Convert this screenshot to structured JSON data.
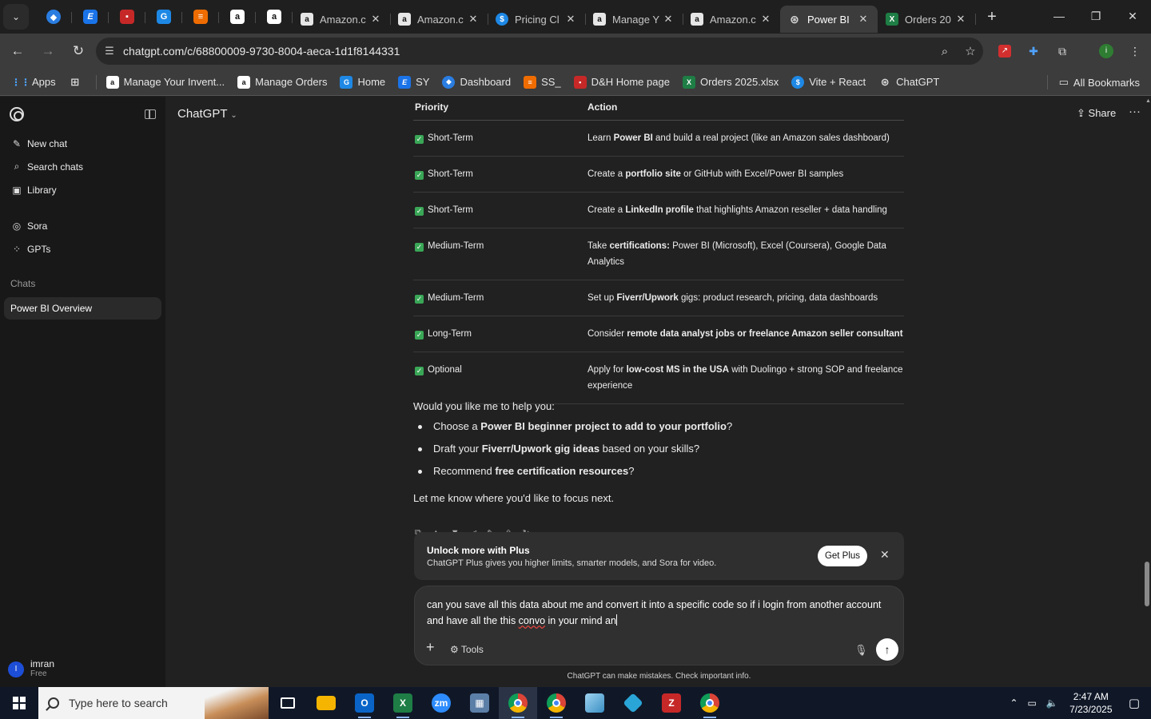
{
  "browser": {
    "tabs": [
      {
        "title": "Amazon.c",
        "icon_letter": "a"
      },
      {
        "title": "Amazon.c",
        "icon_letter": "a"
      },
      {
        "title": "Pricing Cl",
        "icon_letter": "$"
      },
      {
        "title": "Manage Y",
        "icon_letter": "a"
      },
      {
        "title": "Amazon.c",
        "icon_letter": "a"
      },
      {
        "title": "Power BI",
        "icon_letter": "⊛",
        "active": true
      },
      {
        "title": "Orders 20",
        "icon_letter": "X"
      }
    ],
    "url": "chatgpt.com/c/68800009-9730-8004-aeca-1d1f8144331",
    "bookmarks": [
      {
        "label": "Apps"
      },
      {
        "label": "Manage Your Invent..."
      },
      {
        "label": "Manage Orders"
      },
      {
        "label": "Home"
      },
      {
        "label": "SY"
      },
      {
        "label": "Dashboard"
      },
      {
        "label": "SS_"
      },
      {
        "label": "D&H Home page"
      },
      {
        "label": "Orders 2025.xlsx"
      },
      {
        "label": "Vite + React"
      },
      {
        "label": "ChatGPT"
      }
    ],
    "all_bookmarks": "All Bookmarks"
  },
  "sidebar": {
    "items": [
      {
        "label": "New chat",
        "icon": "new-chat-icon"
      },
      {
        "label": "Search chats",
        "icon": "search-icon"
      },
      {
        "label": "Library",
        "icon": "library-icon"
      },
      {
        "label": "Sora",
        "icon": "sora-icon"
      },
      {
        "label": "GPTs",
        "icon": "gpts-icon"
      }
    ],
    "section": "Chats",
    "active_chat": "Power BI Overview",
    "user": {
      "initial": "I",
      "name": "imran",
      "plan": "Free"
    }
  },
  "header": {
    "model": "ChatGPT",
    "share": "Share"
  },
  "table": {
    "headers": [
      "Priority",
      "Action"
    ],
    "rows": [
      {
        "priority": "Short-Term",
        "pre": "Learn ",
        "bold": "Power BI",
        "post": " and build a real project (like an Amazon sales dashboard)"
      },
      {
        "priority": "Short-Term",
        "pre": "Create a ",
        "bold": "portfolio site",
        "post": " or GitHub with Excel/Power BI samples"
      },
      {
        "priority": "Short-Term",
        "pre": "Create a ",
        "bold": "LinkedIn profile",
        "post": " that highlights Amazon reseller + data handling"
      },
      {
        "priority": "Medium-Term",
        "pre": "Take ",
        "bold": "certifications:",
        "post": " Power BI (Microsoft), Excel (Coursera), Google Data Analytics"
      },
      {
        "priority": "Medium-Term",
        "pre": "Set up ",
        "bold": "Fiverr/Upwork",
        "post": " gigs: product research, pricing, data dashboards"
      },
      {
        "priority": "Long-Term",
        "pre": "Consider ",
        "bold": "remote data analyst jobs or freelance Amazon seller consultant",
        "post": ""
      },
      {
        "priority": "Optional",
        "pre": "Apply for ",
        "bold": "low-cost MS in the USA",
        "post": " with Duolingo + strong SOP and freelance experience"
      }
    ]
  },
  "reply": {
    "intro": "Would you like me to help you:",
    "bullets": [
      {
        "pre": "Choose a ",
        "bold": "Power BI beginner project to add to your portfolio",
        "post": "?"
      },
      {
        "pre": "Draft your ",
        "bold": "Fiverr/Upwork gig ideas",
        "post": " based on your skills?"
      },
      {
        "pre": "Recommend ",
        "bold": "free certification resources",
        "post": "?"
      }
    ],
    "outro": "Let me know where you'd like to focus next."
  },
  "banner": {
    "title": "Unlock more with Plus",
    "subtitle": "ChatGPT Plus gives you higher limits, smarter models, and Sora for video.",
    "button": "Get Plus"
  },
  "composer": {
    "text_a": "can you save all this data about me and convert it into a specific code so if i login  from another account and have all the this ",
    "text_misspelled": "convo",
    "text_b": " in your mind an",
    "tools": "Tools"
  },
  "disclaimer": "ChatGPT can make mistakes. Check important info.",
  "taskbar": {
    "search_placeholder": "Type here to search",
    "time": "2:47 AM",
    "date": "7/23/2025"
  },
  "colors": {
    "check": "#3aa757",
    "accent_blue": "#1d4ed8"
  }
}
